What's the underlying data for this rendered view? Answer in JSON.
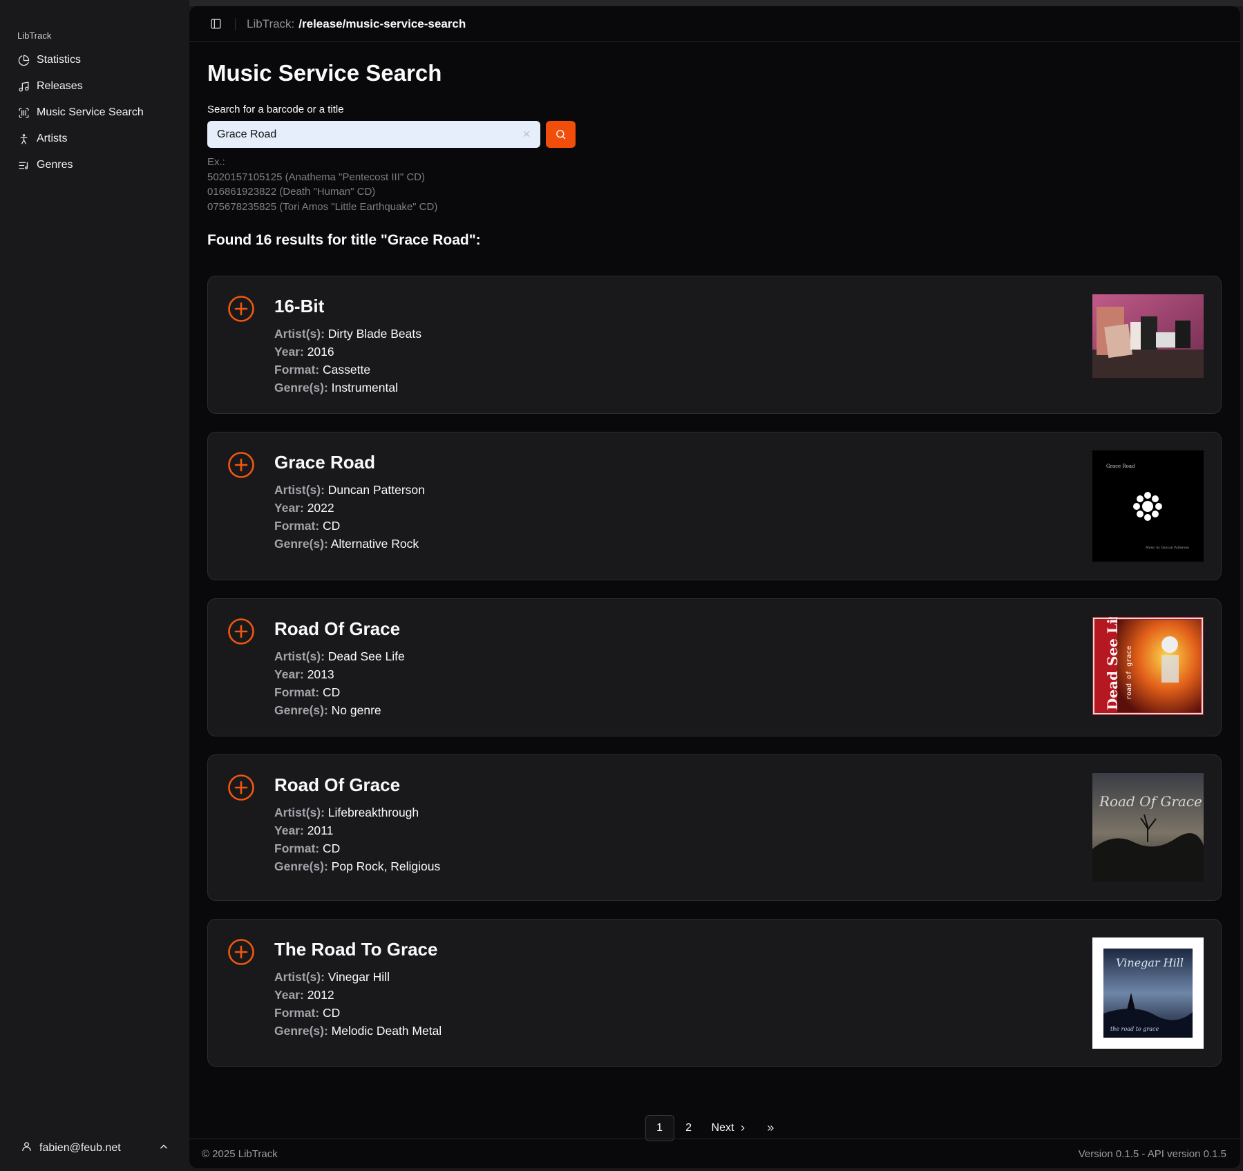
{
  "app": {
    "brand": "LibTrack"
  },
  "sidebar": {
    "items": [
      {
        "label": "Statistics",
        "icon": "pie-chart-icon"
      },
      {
        "label": "Releases",
        "icon": "music-note-icon"
      },
      {
        "label": "Music Service Search",
        "icon": "barcode-scan-icon"
      },
      {
        "label": "Artists",
        "icon": "person-icon"
      },
      {
        "label": "Genres",
        "icon": "list-music-icon"
      }
    ],
    "user_email": "fabien@feub.net"
  },
  "topbar": {
    "prefix": "LibTrack:",
    "path": "/release/music-service-search"
  },
  "page": {
    "title": "Music Service Search",
    "search_label": "Search for a barcode or a title",
    "search_value": "Grace Road",
    "examples": [
      "Ex.:",
      "5020157105125 (Anathema \"Pentecost III\" CD)",
      "016861923822 (Death \"Human\" CD)",
      "075678235825 (Tori Amos \"Little Earthquake\" CD)"
    ],
    "results_heading": "Found 16 results for title \"Grace Road\":"
  },
  "labels": {
    "artists": "Artist(s):",
    "year": "Year:",
    "format": "Format:",
    "genres": "Genre(s):"
  },
  "results": [
    {
      "title": "16-Bit",
      "artists": "Dirty Blade Beats",
      "year": "2016",
      "format": "Cassette",
      "genres": "Instrumental"
    },
    {
      "title": "Grace Road",
      "artists": "Duncan Patterson",
      "year": "2022",
      "format": "CD",
      "genres": "Alternative Rock",
      "cover_text_top": "Grace Road",
      "cover_text_bottom": "Music by Duncan Patterson"
    },
    {
      "title": "Road Of Grace",
      "artists": "Dead See Life",
      "year": "2013",
      "format": "CD",
      "genres": "No genre",
      "cover_text_band": "Dead See Life",
      "cover_text_album": "road of grace"
    },
    {
      "title": "Road Of Grace",
      "artists": "Lifebreakthrough",
      "year": "2011",
      "format": "CD",
      "genres": "Pop Rock, Religious",
      "cover_text_album": "Road Of Grace"
    },
    {
      "title": "The Road To Grace",
      "artists": "Vinegar Hill",
      "year": "2012",
      "format": "CD",
      "genres": "Melodic Death Metal",
      "cover_text_band": "Vinegar Hill",
      "cover_text_album": "the road to grace"
    }
  ],
  "pagination": {
    "pages": [
      "1",
      "2"
    ],
    "next": "Next",
    "active": "1"
  },
  "footer": {
    "copyright": "© 2025 LibTrack",
    "version": "Version 0.1.5 - API version 0.1.5"
  },
  "colors": {
    "accent": "#f04e0a",
    "background": "#09090b",
    "card": "#19191c"
  }
}
